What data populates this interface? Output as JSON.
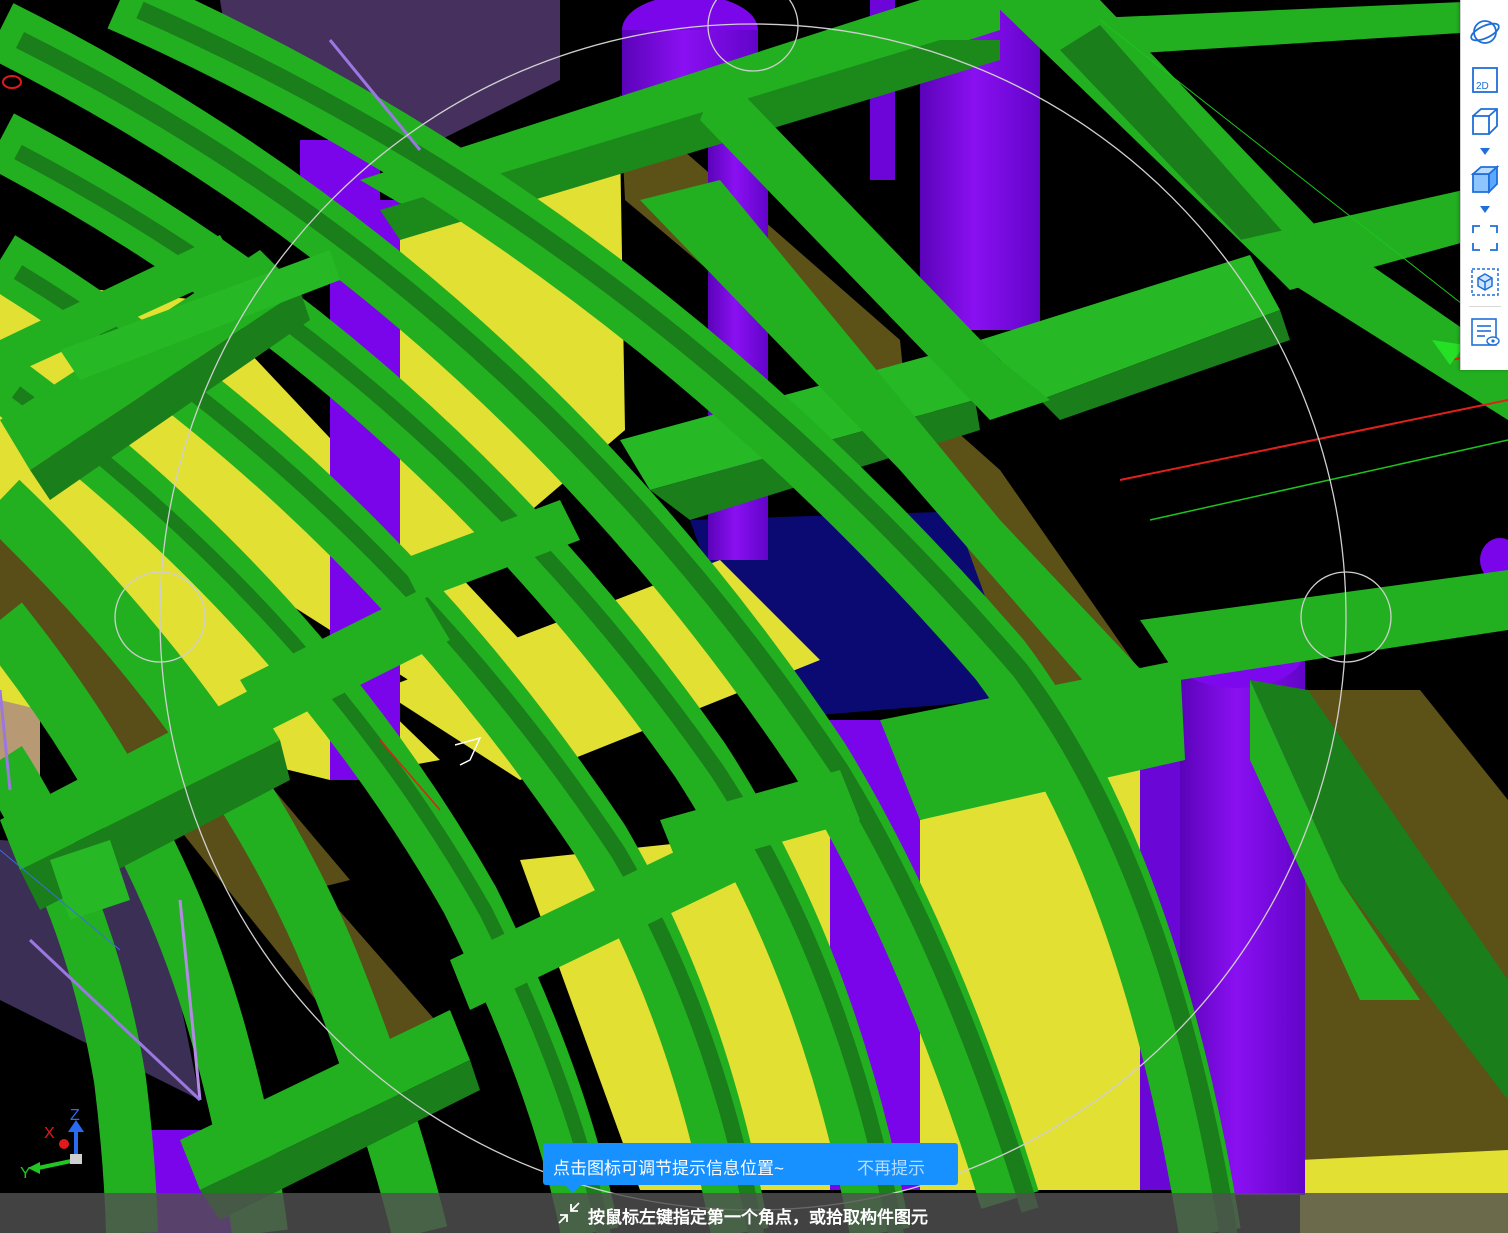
{
  "view": {
    "background": "#000000",
    "colors": {
      "beam_green": "#22b021",
      "beam_green_dark": "#1a7e1a",
      "beam_green_light": "#2ec42c",
      "column_purple": "#7b05ea",
      "column_purple_dark": "#5203a8",
      "wall_yellow": "#e4e033",
      "wall_olive": "#5e531a",
      "slab_navy": "#0a0a6e",
      "orbit_circle": "#c8c8c8"
    }
  },
  "toolbar": {
    "items": [
      {
        "name": "orbit",
        "icon": "orbit-icon"
      },
      {
        "name": "2d",
        "icon": "view-2d-icon",
        "label": "2D"
      },
      {
        "name": "3d-wire",
        "icon": "cube-outline-icon"
      },
      {
        "name": "3d-solid",
        "icon": "cube-solid-icon"
      },
      {
        "name": "fullscreen",
        "icon": "fullscreen-corners-icon"
      },
      {
        "name": "select-3d",
        "icon": "cube-in-box-icon"
      },
      {
        "name": "display-settings",
        "icon": "list-eye-icon"
      }
    ]
  },
  "tip": {
    "text": "点击图标可调节提示信息位置~",
    "dismiss": "不再提示"
  },
  "status": {
    "text": "按鼠标左键指定第一个角点，或拾取构件图元"
  },
  "axes": {
    "x": "X",
    "y": "Y",
    "z": "Z"
  }
}
